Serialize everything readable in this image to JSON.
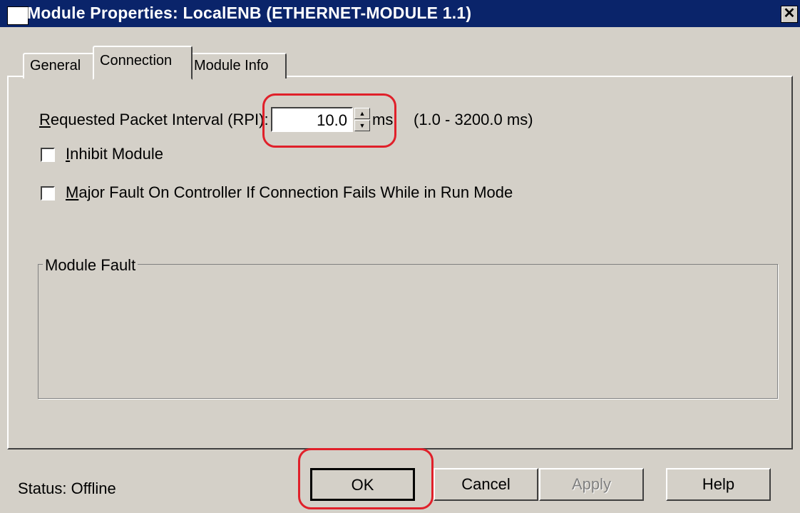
{
  "window": {
    "title": "Module Properties: LocalENB (ETHERNET-MODULE 1.1)",
    "close_glyph": "✕"
  },
  "tabs": [
    {
      "label": "General"
    },
    {
      "label": "Connection"
    },
    {
      "label": "Module Info"
    }
  ],
  "rpi": {
    "label_first": "R",
    "label_rest": "equested Packet Interval (RPI):",
    "value": "10.0",
    "unit": "ms",
    "range": "(1.0 - 3200.0 ms)"
  },
  "inhibit": {
    "label_first": "I",
    "label_rest": "nhibit Module",
    "checked": false
  },
  "major_fault": {
    "label_first": "M",
    "label_rest": "ajor Fault On Controller If Connection Fails While in Run Mode",
    "checked": false
  },
  "module_fault": {
    "legend": "Module Fault"
  },
  "footer": {
    "status": "Status:  Offline",
    "ok": "OK",
    "cancel": "Cancel",
    "apply": "Apply",
    "help": "Help"
  },
  "colors": {
    "titlebar": "#0a246a",
    "annotation": "#e0202a",
    "face": "#d4d0c8"
  }
}
